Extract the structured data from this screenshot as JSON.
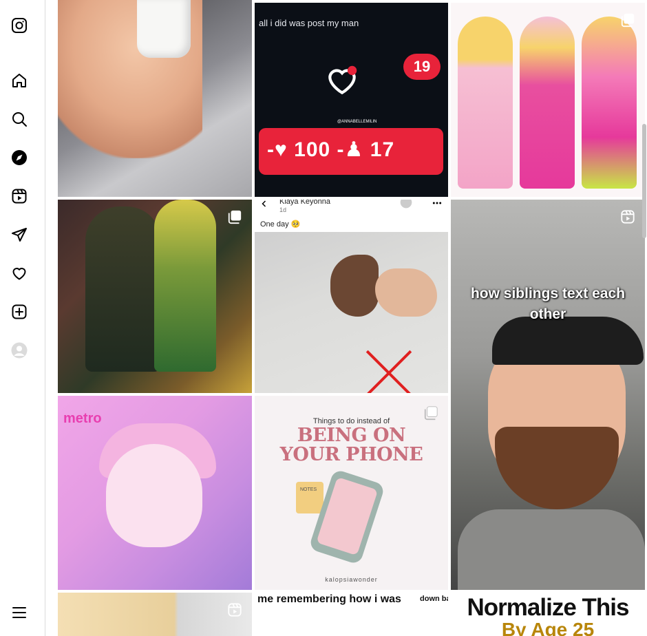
{
  "sidebar": {
    "items": [
      {
        "icon": "instagram-logo-icon"
      },
      {
        "icon": "home-icon"
      },
      {
        "icon": "search-icon"
      },
      {
        "icon": "explore-icon"
      },
      {
        "icon": "reels-icon"
      },
      {
        "icon": "messages-icon"
      },
      {
        "icon": "notifications-heart-icon"
      },
      {
        "icon": "create-icon"
      },
      {
        "icon": "profile-avatar-icon"
      },
      {
        "icon": "more-menu-icon"
      }
    ]
  },
  "grid": {
    "tiles": [
      {
        "type": "photo"
      },
      {
        "type": "photo",
        "caption": "all i did was post my man",
        "watermark": "@ANNABELLEMILIN",
        "notification_count": "19",
        "likes": "100",
        "followers": "17"
      },
      {
        "type": "carousel"
      },
      {
        "type": "carousel"
      },
      {
        "type": "photo",
        "author": "Kiaya Keyonna",
        "time": "1d",
        "text": "One day 🥺"
      },
      {
        "type": "reel",
        "caption_line1": "how siblings text each",
        "caption_line2": "other"
      },
      {
        "type": "photo",
        "text": "metro"
      },
      {
        "type": "carousel",
        "subtitle": "Things to do instead of",
        "title_line1": "BEING ON",
        "title_line2": "YOUR PHONE",
        "notes_label": "NOTES",
        "watermark": "kalopsiawonder"
      },
      {
        "type": "reel"
      },
      {
        "type": "photo",
        "text": "me remembering how i was",
        "text2": "down ba"
      },
      {
        "type": "photo",
        "title_line1": "Normalize This",
        "title_line2": "By Age 25"
      }
    ]
  },
  "colors": {
    "accent_red": "#e8233a",
    "border": "#dbdbdb"
  }
}
